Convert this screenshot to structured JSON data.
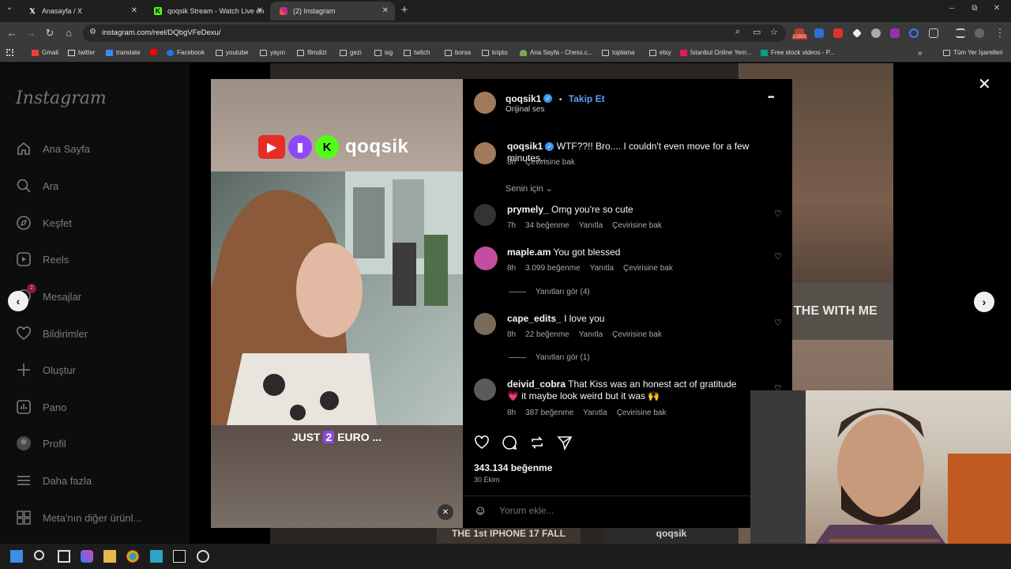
{
  "browser": {
    "tabs": [
      {
        "title": "Anasayfa / X",
        "icon": "x-logo-icon"
      },
      {
        "title": "qoqsik Stream - Watch Live on",
        "icon": "kick-logo-icon"
      },
      {
        "title": "(2) Instagram",
        "icon": "instagram-logo-icon"
      }
    ],
    "new_tab": "+",
    "url": "instagram.com/reel/DQbgVFeDexu/",
    "window_controls": [
      "–",
      "⧉",
      "✕"
    ],
    "ext_badge": "21925"
  },
  "bookmarks": {
    "items": [
      {
        "label": "Gmail",
        "icon": "gmail-icon"
      },
      {
        "label": "twitter",
        "icon": "x-logo-icon"
      },
      {
        "label": "translate",
        "icon": "translate-icon"
      },
      {
        "label": "",
        "icon": "youtube-icon"
      },
      {
        "label": "Facebook",
        "icon": "facebook-icon"
      },
      {
        "label": "youtube",
        "icon": "folder-icon"
      },
      {
        "label": "yayın",
        "icon": "folder-icon"
      },
      {
        "label": "filmdizi",
        "icon": "folder-icon"
      },
      {
        "label": "gezi",
        "icon": "folder-icon"
      },
      {
        "label": "isg",
        "icon": "folder-icon"
      },
      {
        "label": "twitch",
        "icon": "folder-icon"
      },
      {
        "label": "borsa",
        "icon": "folder-icon"
      },
      {
        "label": "kripto",
        "icon": "folder-icon"
      },
      {
        "label": "Ana Sayfa - Chess.c...",
        "icon": "chess-icon"
      },
      {
        "label": "toplama",
        "icon": "folder-icon"
      },
      {
        "label": "etsy",
        "icon": "folder-icon"
      },
      {
        "label": "İstanbul Online Yem...",
        "icon": "yemek-icon"
      },
      {
        "label": "Free stock videos - P...",
        "icon": "pexels-icon"
      }
    ],
    "more": "»",
    "all_bookmarks": "Tüm Yer İşaretleri"
  },
  "sidebar": {
    "logo": "Instagram",
    "items": [
      {
        "label": "Ana Sayfa",
        "icon": "home-icon"
      },
      {
        "label": "Ara",
        "icon": "search-icon"
      },
      {
        "label": "Keşfet",
        "icon": "compass-icon"
      },
      {
        "label": "Reels",
        "icon": "reels-icon"
      },
      {
        "label": "Mesajlar",
        "icon": "messenger-icon",
        "badge": "2"
      },
      {
        "label": "Bildirimler",
        "icon": "heart-icon"
      },
      {
        "label": "Oluştur",
        "icon": "plus-icon"
      },
      {
        "label": "Pano",
        "icon": "dashboard-icon"
      },
      {
        "label": "Profil",
        "icon": "avatar-icon"
      },
      {
        "label": "Daha fazla",
        "icon": "menu-icon"
      },
      {
        "label": "Meta'nın diğer ürünl...",
        "icon": "meta-icon"
      }
    ]
  },
  "reel": {
    "channel_name": "qoqsik",
    "subtitle_before": "JUST ",
    "subtitle_highlight": "2",
    "subtitle_after": " EURO ..."
  },
  "post": {
    "author": "qoqsik1",
    "follow_label": "Takip Et",
    "audio": "Orijinal ses",
    "more": "•••",
    "caption": {
      "user": "qoqsik1",
      "text": "WTF??!! Bro.... I couldn't even move for a few minutes...",
      "time": "8h",
      "translate": "Çevirisine bak"
    },
    "sort_label": "Senin için",
    "comments": [
      {
        "user": "prymely_",
        "text": "Omg you're so cute",
        "time": "7h",
        "likes": "34 beğenme",
        "reply": "Yanıtla",
        "translate": "Çevirisine bak"
      },
      {
        "user": "maple.am",
        "text": "You got blessed",
        "time": "8h",
        "likes": "3.099 beğenme",
        "reply": "Yanıtla",
        "translate": "Çevirisine bak",
        "replies": "Yanıtları gör (4)"
      },
      {
        "user": "cape_edits_",
        "text": "I love you",
        "time": "8h",
        "likes": "22 beğenme",
        "reply": "Yanıtla",
        "translate": "Çevirisine bak",
        "replies": "Yanıtları gör (1)"
      },
      {
        "user": "deivid_cobra",
        "text": "That Kiss was an honest act of gratitude 💗 it maybe look weird but it was 🙌",
        "time": "8h",
        "likes": "387 beğenme",
        "reply": "Yanıtla",
        "translate": "Çevirisine bak"
      }
    ],
    "like_count": "343.134 beğenme",
    "date": "30 Ekim",
    "add_comment_placeholder": "Yorum ekle..."
  },
  "background": {
    "right_caption": "THE WITH ME",
    "bottom_caption_left": "THE 1st IPHONE 17 FALL",
    "bottom_caption_right": "qoqsik"
  },
  "colors": {
    "accent_blue": "#5d9cfa",
    "verified": "#3897f0",
    "reel_highlight": "#8b4ad8"
  }
}
